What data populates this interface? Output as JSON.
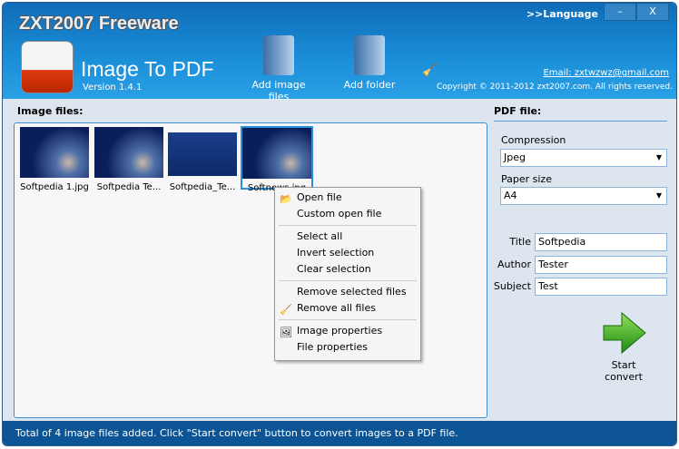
{
  "header": {
    "brand": "ZXT2007 Freeware",
    "product": "Image To PDF",
    "version": "Version 1.4.1",
    "language": ">>Language",
    "minimize": "–",
    "close": "X",
    "email": "Email: zxtwzwz@gmail.com",
    "copyright": "Copyright ©  2011-2012 zxt2007.com. All rights reserved."
  },
  "toolbar": {
    "add_files": "Add image files",
    "add_folder": "Add folder"
  },
  "images": {
    "title": "Image files:",
    "files": [
      "Softpedia 1.jpg",
      "Softpedia Te...",
      "Softpedia_Te...",
      "Softnews.jpg"
    ]
  },
  "menu": {
    "open": "Open file",
    "custom_open": "Custom open file",
    "select_all": "Select all",
    "invert": "Invert selection",
    "clear": "Clear selection",
    "remove_selected": "Remove selected files",
    "remove_all": "Remove all files",
    "image_props": "Image properties",
    "file_props": "File properties"
  },
  "pdf": {
    "title": "PDF file:",
    "compression_label": "Compression",
    "compression": "Jpeg",
    "paper_label": "Paper size",
    "paper": "A4",
    "title_label": "Title",
    "title_value": "Softpedia",
    "author_label": "Author",
    "author_value": "Tester",
    "subject_label": "Subject",
    "subject_value": "Test",
    "start": "Start convert"
  },
  "status": "Total of 4 image files added. Click \"Start convert\" button to convert images to a PDF file."
}
